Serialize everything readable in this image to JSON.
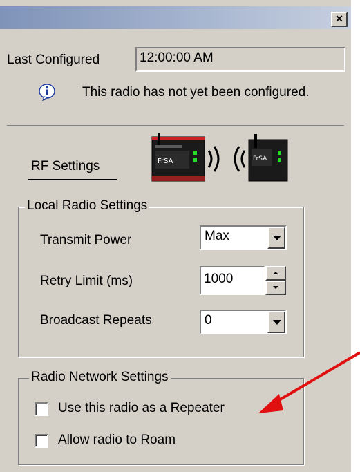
{
  "window": {
    "close_glyph": "×"
  },
  "config": {
    "last_configured_label": "Last Configured",
    "last_configured_value": "12:00:00 AM",
    "info_message": "This radio has not yet been configured."
  },
  "tabs": {
    "rf_settings_label": "RF Settings"
  },
  "local_radio": {
    "group_title": "Local Radio Settings",
    "transmit_power_label": "Transmit Power",
    "transmit_power_value": "Max",
    "retry_limit_label": "Retry Limit (ms)",
    "retry_limit_value": "1000",
    "broadcast_repeats_label": "Broadcast Repeats",
    "broadcast_repeats_value": "0"
  },
  "network": {
    "group_title": "Radio Network Settings",
    "repeater_label": "Use this radio as a Repeater",
    "repeater_checked": false,
    "roam_label": "Allow radio to Roam",
    "roam_checked": false
  },
  "colors": {
    "panel_bg": "#d4d0c8",
    "annotation_arrow": "#e01010"
  }
}
